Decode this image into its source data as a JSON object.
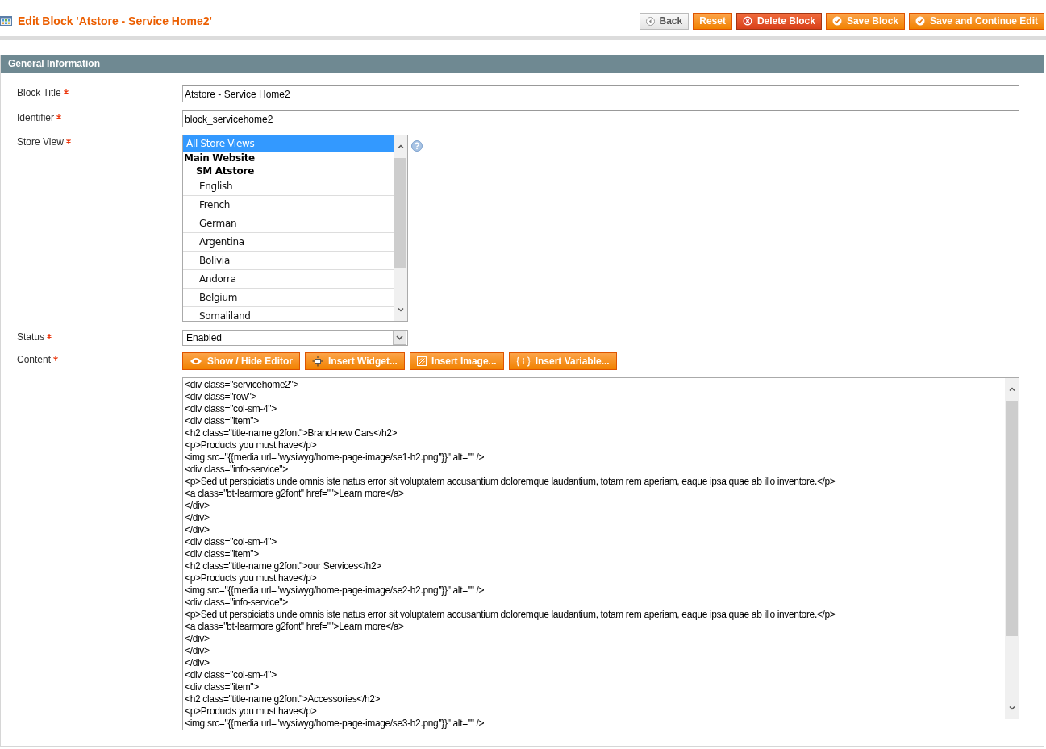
{
  "page_title": "Edit Block 'Atstore - Service Home2'",
  "header_buttons": [
    {
      "label": "Back",
      "kind": "back"
    },
    {
      "label": "Reset",
      "kind": "plain"
    },
    {
      "label": "Delete Block",
      "kind": "delete"
    },
    {
      "label": "Save Block",
      "kind": "save"
    },
    {
      "label": "Save and Continue Edit",
      "kind": "save"
    }
  ],
  "section_title": "General Information",
  "fields": {
    "block_title": {
      "label": "Block Title",
      "required": true,
      "value": "Atstore - Service Home2"
    },
    "identifier": {
      "label": "Identifier",
      "required": true,
      "value": "block_servicehome2"
    },
    "store_view": {
      "label": "Store View",
      "required": true,
      "options": [
        {
          "label": "All Store Views",
          "selected": true
        },
        {
          "label": "Main Website",
          "children": [
            {
              "label": "SM Atstore",
              "children": [
                {
                  "label": "English",
                  "selected": false
                },
                {
                  "label": "French",
                  "selected": false
                },
                {
                  "label": "German",
                  "selected": false
                },
                {
                  "label": "Argentina",
                  "selected": false
                },
                {
                  "label": "Bolivia",
                  "selected": false
                },
                {
                  "label": "Andorra",
                  "selected": false
                },
                {
                  "label": "Belgium",
                  "selected": false
                },
                {
                  "label": "Somaliland",
                  "selected": false
                }
              ]
            }
          ]
        }
      ]
    },
    "status": {
      "label": "Status",
      "required": true,
      "value": "Enabled"
    },
    "content": {
      "label": "Content",
      "required": true,
      "buttons": [
        {
          "label": "Show / Hide Editor",
          "kind": "eye"
        },
        {
          "label": "Insert Widget...",
          "kind": "widget"
        },
        {
          "label": "Insert Image...",
          "kind": "image"
        },
        {
          "label": "Insert Variable...",
          "kind": "variable"
        }
      ],
      "lines": [
        "<div class=\"servicehome2\">",
        "<div class=\"row\">",
        "<div class=\"col-sm-4\">",
        "<div class=\"item\">",
        "<h2 class=\"title-name g2font\">Brand-new Cars</h2>",
        "<p>Products you must have</p>",
        "<img src=\"{{media url=\"wysiwyg/home-page-image/se1-h2.png\"}}\" alt=\"\" />",
        "<div class=\"info-service\">",
        "<p>Sed ut perspiciatis unde omnis iste natus error sit voluptatem accusantium doloremque laudantium, totam rem aperiam, eaque ipsa quae ab illo inventore.</p>",
        "<a class=\"bt-learmore g2font\" href=\"\">Learn more</a>",
        "</div>",
        "</div>",
        "</div>",
        "<div class=\"col-sm-4\">",
        "<div class=\"item\">",
        "<h2 class=\"title-name g2font\">our Services</h2>",
        "<p>Products you must have</p>",
        "<img src=\"{{media url=\"wysiwyg/home-page-image/se2-h2.png\"}}\" alt=\"\" />",
        "<div class=\"info-service\">",
        "<p>Sed ut perspiciatis unde omnis iste natus error sit voluptatem accusantium doloremque laudantium, totam rem aperiam, eaque ipsa quae ab illo inventore.</p>",
        "<a class=\"bt-learmore g2font\" href=\"\">Learn more</a>",
        "</div>",
        "</div>",
        "</div>",
        "<div class=\"col-sm-4\">",
        "<div class=\"item\">",
        "<h2 class=\"title-name g2font\">Accessories</h2>",
        "<p>Products you must have</p>",
        "<img src=\"{{media url=\"wysiwyg/home-page-image/se3-h2.png\"}}\" alt=\"\" />"
      ]
    }
  }
}
